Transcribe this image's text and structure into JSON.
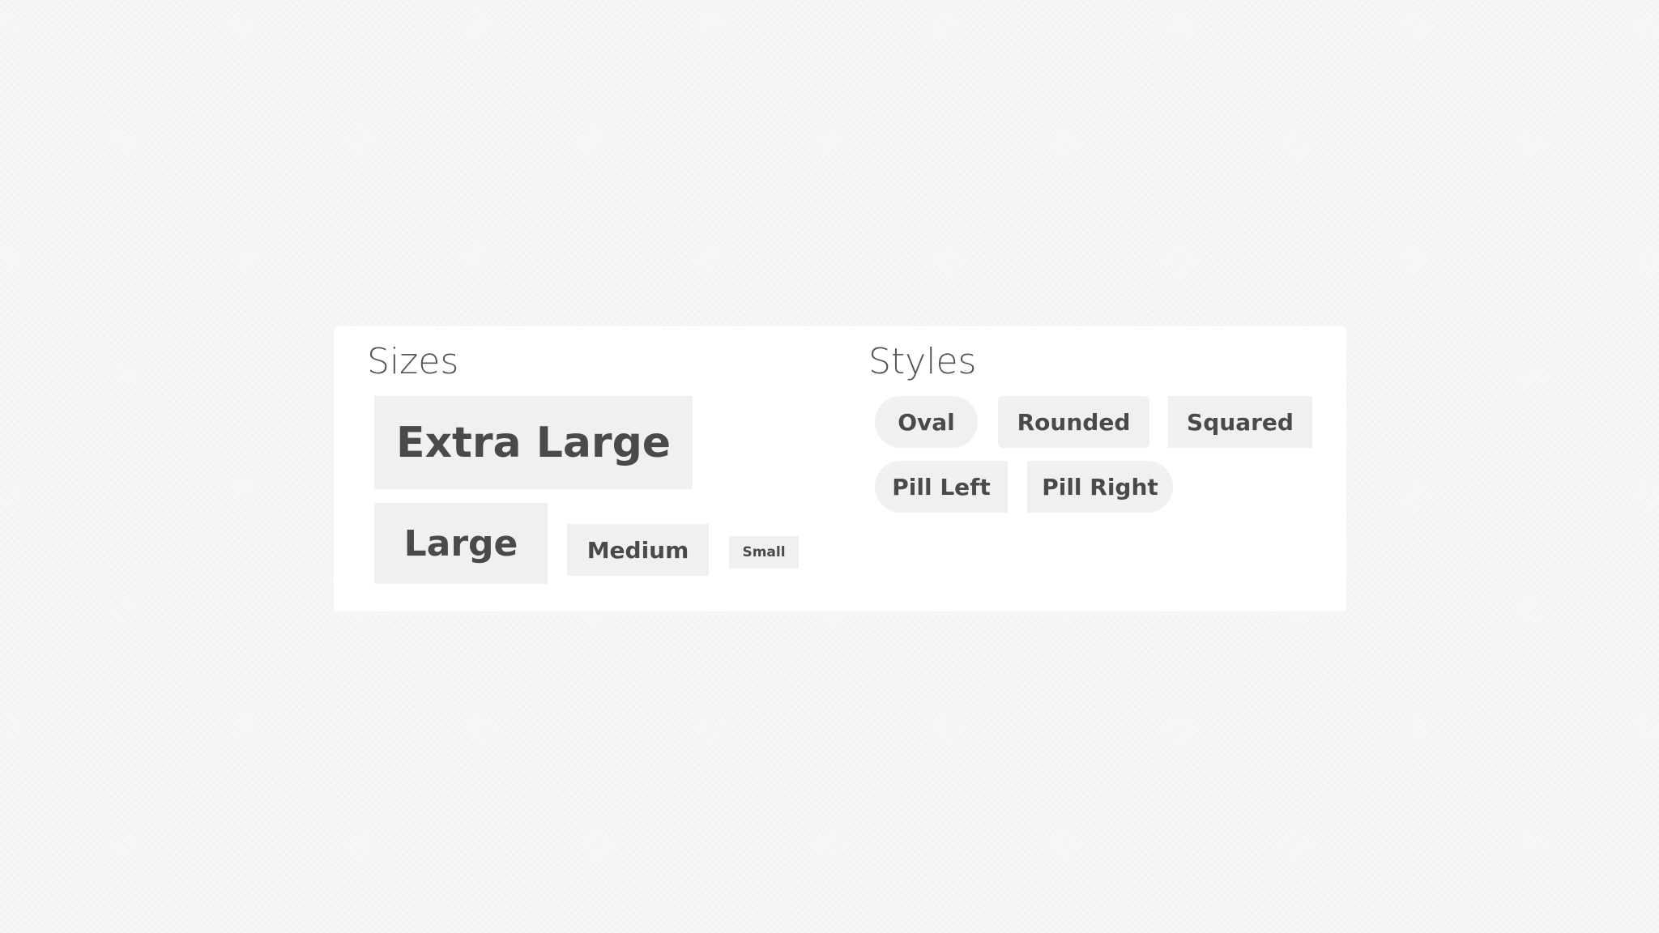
{
  "sizes": {
    "title": "Sizes",
    "extra_large_label": "Extra Large",
    "large_label": "Large",
    "medium_label": "Medium",
    "small_label": "Small"
  },
  "styles": {
    "title": "Styles",
    "oval_label": "Oval",
    "rounded_label": "Rounded",
    "squared_label": "Squared",
    "pill_left_label": "Pill Left",
    "pill_right_label": "Pill Right"
  },
  "colors": {
    "button_bg": "#f0f0f1",
    "button_text": "#4a4a4a",
    "heading_text": "#555555",
    "panel_bg": "#ffffff"
  }
}
